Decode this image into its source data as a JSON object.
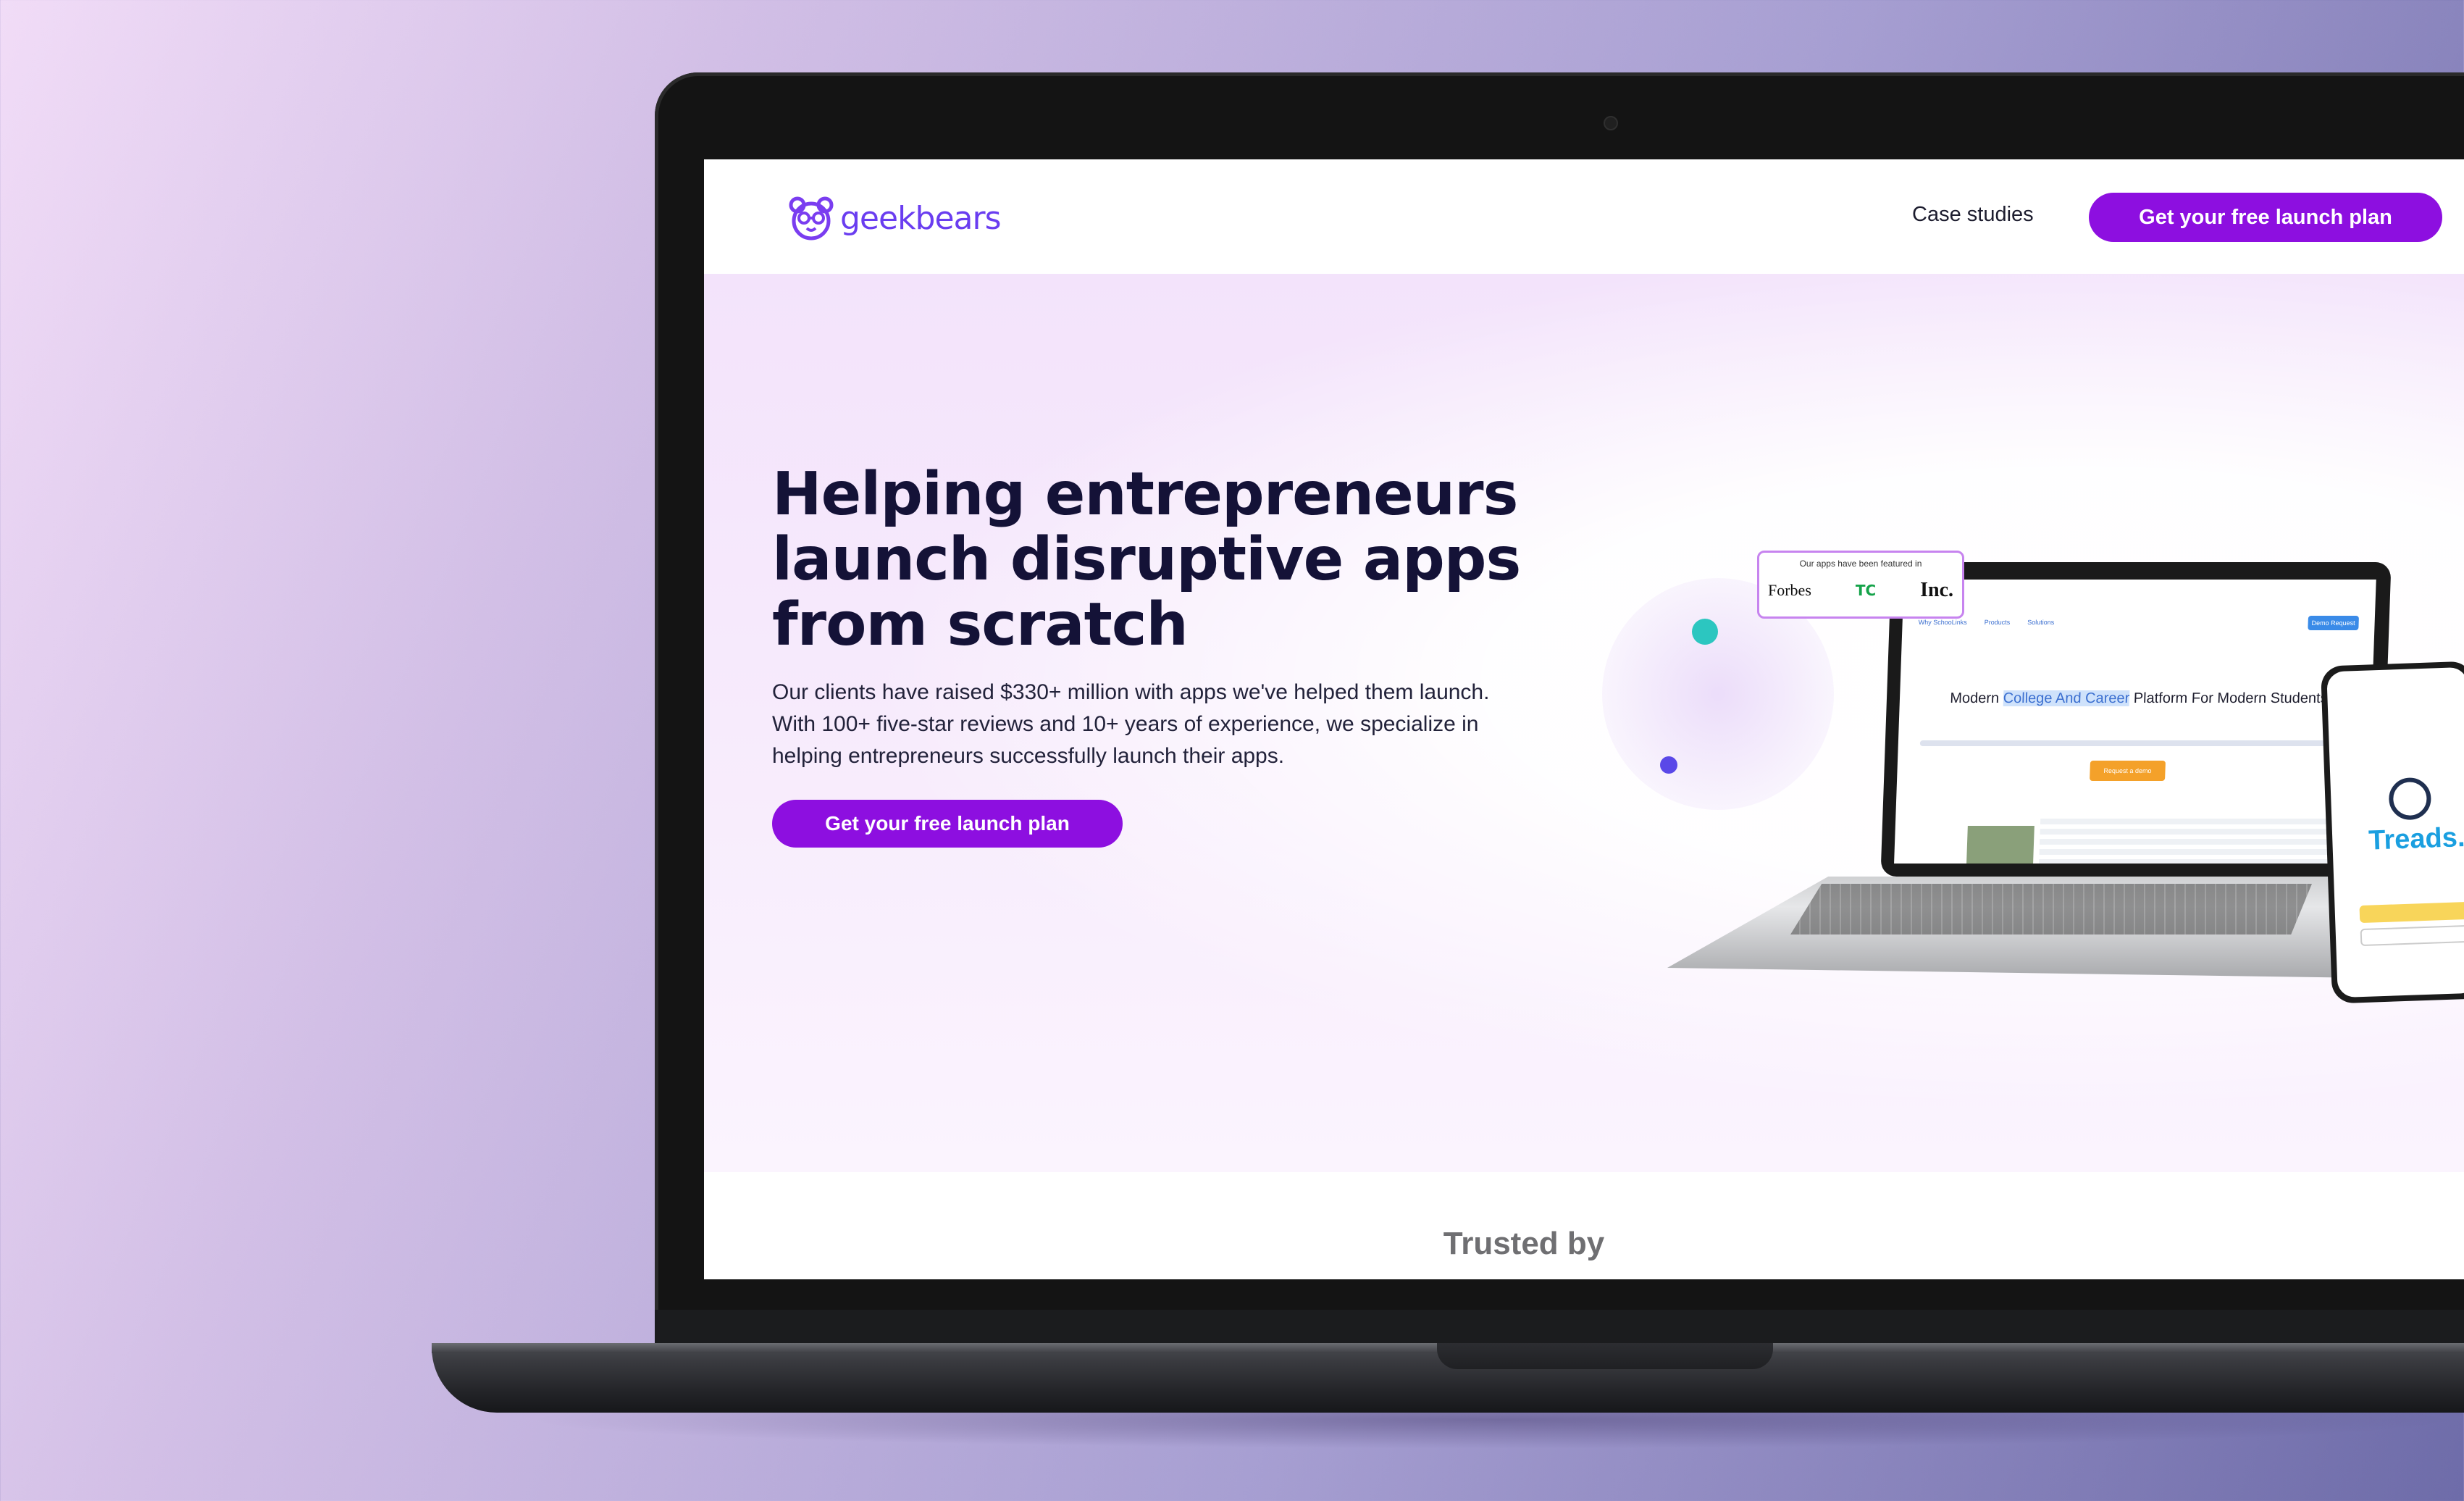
{
  "brand": {
    "name": "geekbears",
    "accent": "#8d0fe0",
    "logo_color": "#6a3df0"
  },
  "nav": {
    "links": [
      "Case studies"
    ],
    "cta_label": "Get your free launch plan"
  },
  "hero": {
    "headline": "Helping entrepreneurs launch disruptive apps from scratch",
    "subtext": "Our clients have raised $330+ million with apps we've helped them launch. With 100+ five-star reviews and 10+ years of experience, we specialize in helping entrepreneurs successfully launch their apps.",
    "cta_label": "Get your free launch plan"
  },
  "mockup": {
    "featured_title": "Our apps have been featured in",
    "featured_logos": [
      "Forbes",
      "TC",
      "Inc."
    ],
    "laptop_title_pre": "Modern ",
    "laptop_title_highlight": "College And Career",
    "laptop_title_post": " Platform For Modern Students",
    "laptop_cta": "Request a demo",
    "laptop_demo_button": "Demo Request",
    "phone_app_name": "Treads."
  },
  "trusted": {
    "label": "Trusted by"
  }
}
